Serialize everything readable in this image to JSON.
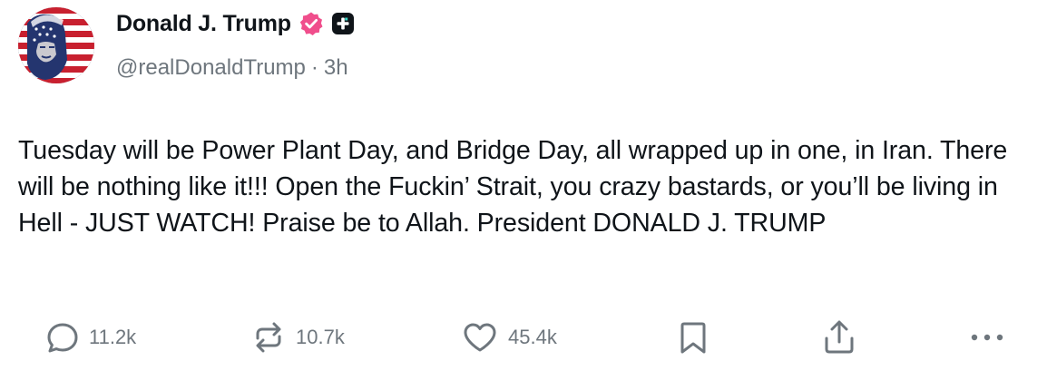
{
  "author": {
    "display_name": "Donald J. Trump",
    "handle": "@realDonaldTrump",
    "separator": "·",
    "time_ago": "3h",
    "verified_color": "#f04e8c"
  },
  "post": {
    "text": "Tuesday will be Power Plant Day, and Bridge Day, all wrapped up in one, in Iran. There will be nothing like it!!! Open the Fuckin’ Strait, you crazy bastards, or you’ll be living in Hell - JUST WATCH! Praise be to Allah. President DONALD J. TRUMP"
  },
  "actions": {
    "reply_count": "11.2k",
    "retruth_count": "10.7k",
    "like_count": "45.4k"
  },
  "colors": {
    "text": "#0f1419",
    "muted": "#6e767d"
  }
}
